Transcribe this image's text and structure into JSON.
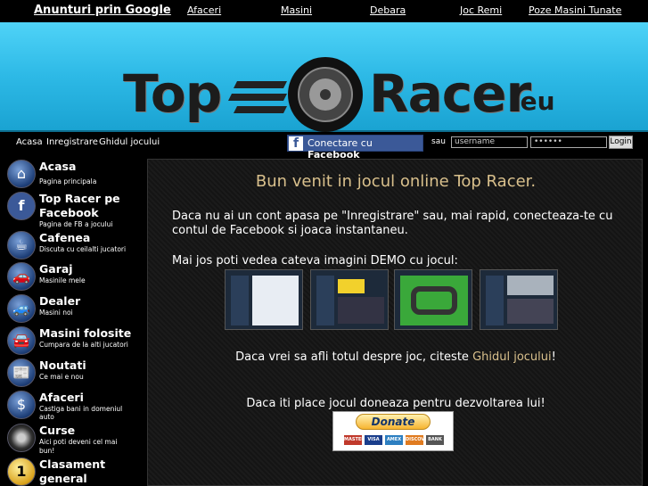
{
  "topbar": {
    "ads_label": "Anunturi prin Google",
    "links": [
      "Afaceri",
      "Masini",
      "Debara",
      "Joc Remi",
      "Poze Masini Tunate"
    ]
  },
  "banner": {
    "logo_top": "Top",
    "logo_racer": "Racer",
    "logo_eu": ".eu"
  },
  "loginbar": {
    "nav": [
      "Acasa",
      "Inregistrare",
      "Ghidul jocului"
    ],
    "facebook_prefix": "Conectare cu ",
    "facebook_brand": "Facebook",
    "sau": "sau",
    "username_value": "username",
    "password_value": "••••••",
    "login_label": "Login"
  },
  "sidebar": {
    "items": [
      {
        "title": "Acasa",
        "sub": "Pagina principala",
        "icon": "house-icon"
      },
      {
        "title": "Top Racer pe Facebook",
        "sub": "Pagina de FB a jocului",
        "icon": "facebook-icon"
      },
      {
        "title": "Cafenea",
        "sub": "Discuta cu ceilalti jucatori",
        "icon": "coffee-icon"
      },
      {
        "title": "Garaj",
        "sub": "Masinile mele",
        "icon": "garage-car-icon"
      },
      {
        "title": "Dealer",
        "sub": "Masini noi",
        "icon": "dealer-car-icon"
      },
      {
        "title": "Masini folosite",
        "sub": "Cumpara de la alti jucatori",
        "icon": "used-car-icon"
      },
      {
        "title": "Noutati",
        "sub": "Ce mai e nou",
        "icon": "newspaper-icon"
      },
      {
        "title": "Afaceri",
        "sub": "Castiga bani in domeniul auto",
        "icon": "dollar-icon"
      },
      {
        "title": "Curse",
        "sub": "Aici poti deveni cel mai bun!",
        "icon": "wheel-icon"
      },
      {
        "title": "Clasament general",
        "sub": "",
        "icon": "medal-icon"
      }
    ]
  },
  "main": {
    "welcome": "Bun venit in jocul online Top Racer.",
    "para1": "Daca nu ai un cont apasa pe \"Inregistrare\" sau, mai rapid, conecteaza-te cu contul de Facebook si joaca instantaneu.",
    "para2": "Mai jos poti vedea cateva imagini DEMO cu jocul:",
    "guide_prefix": "Daca vrei sa afli totul despre joc, citeste ",
    "guide_link": "Ghidul jocului",
    "guide_suffix": "!",
    "donate_text": "Daca iti place jocul doneaza pentru dezvoltarea lui!",
    "donate_button": "Donate",
    "cards": [
      "MASTER",
      "VISA",
      "AMEX",
      "DISCOVER",
      "BANK"
    ]
  },
  "colors": {
    "banner": "#2db9e6",
    "accent_gold": "#d9c08c",
    "facebook": "#3b5998"
  }
}
